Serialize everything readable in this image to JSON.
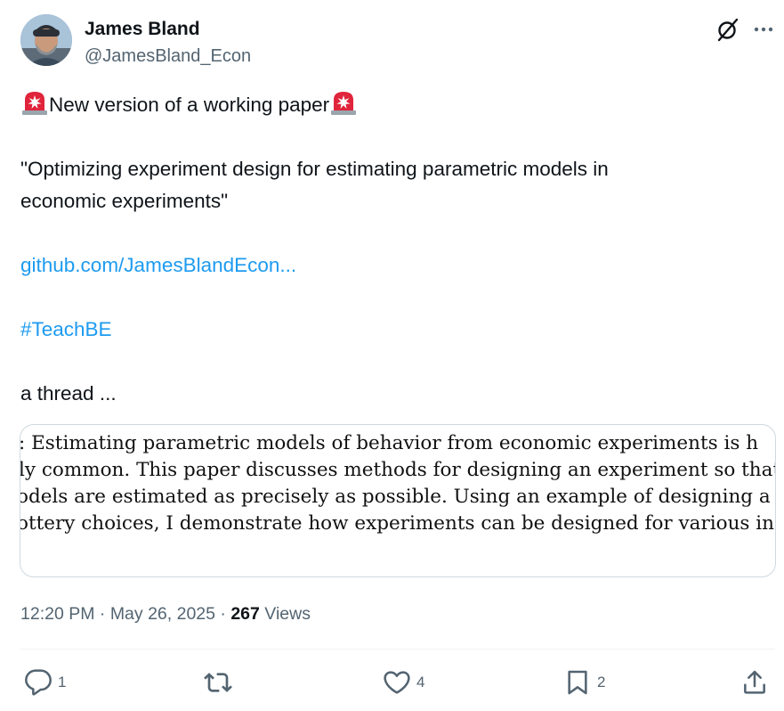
{
  "author": {
    "name": "James Bland",
    "handle": "@JamesBland_Econ"
  },
  "post": {
    "headline": "New version of a working paper",
    "title_line1": "\"Optimizing experiment design for estimating parametric models in",
    "title_line2": "economic experiments\"",
    "link_text": "github.com/JamesBlandEcon...",
    "hashtag": "#TeachBE",
    "closing": "a thread ..."
  },
  "media": {
    "lines": [
      ": Estimating parametric models of behavior from economic experiments is h",
      "ly common.  This paper discusses methods for designing an experiment so that pa",
      "odels are estimated as precisely as possible.  Using an example of designing a b",
      "ottery choices, I demonstrate how experiments can be designed for various in"
    ]
  },
  "meta": {
    "time": "12:20 PM",
    "separator": " · ",
    "date": "May 26, 2025",
    "views_count": "267",
    "views_label": " Views"
  },
  "actions": {
    "replies": "1",
    "reposts": "",
    "likes": "4",
    "bookmarks": "2"
  },
  "icons": {
    "siren": "siren-emoji-icon",
    "grok": "grok-icon",
    "more": "more-icon",
    "reply": "reply-icon",
    "retweet": "retweet-icon",
    "like": "heart-icon",
    "bookmark": "bookmark-icon",
    "share": "share-icon"
  },
  "colors": {
    "link": "#1d9bf0",
    "secondary_text": "#536471",
    "primary_text": "#0f1419",
    "siren_red": "#e0243b"
  }
}
